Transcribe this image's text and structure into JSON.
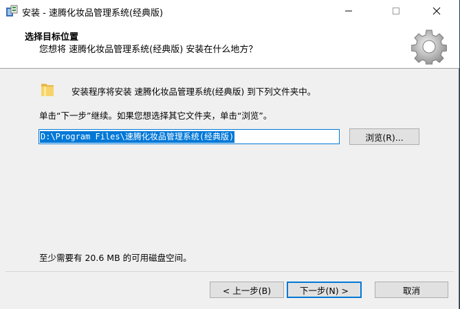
{
  "window": {
    "title": "安装 - 速腾化妆品管理系统(经典版)",
    "controls": [
      "minimize-icon",
      "maximize-icon",
      "close-icon"
    ]
  },
  "header": {
    "title": "选择目标位置",
    "subtitle": "您想将 速腾化妆品管理系统(经典版) 安装在什么地方？"
  },
  "body": {
    "install_to_text": "安装程序将安装 速腾化妆品管理系统(经典版) 到下列文件夹中。",
    "instruction_text": "单击“下一步”继续。如果您想选择其它文件夹，单击“浏览”。",
    "install_path": "D:\\Program Files\\速腾化妆品管理系统(经典版)",
    "browse_label": "浏览(R)...",
    "space_text": "至少需要有 20.6 MB 的可用磁盘空间。"
  },
  "footer": {
    "back_label": "< 上一步(B)",
    "next_label": "下一步(N) >",
    "cancel_label": "取消"
  },
  "colors": {
    "selection": "#0078d7",
    "dialog_bg": "#f0f0f0"
  }
}
